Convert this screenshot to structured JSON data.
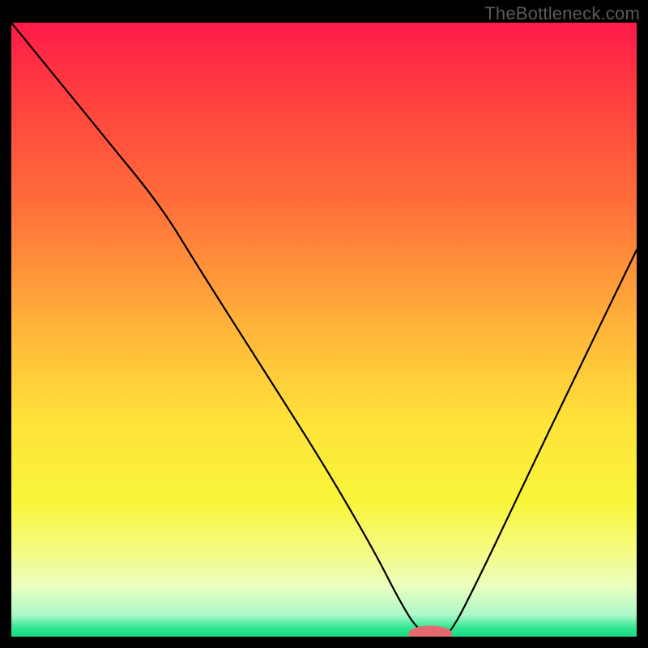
{
  "watermark": "TheBottleneck.com",
  "chart_data": {
    "type": "line",
    "title": "",
    "xlabel": "",
    "ylabel": "",
    "xlim": [
      0,
      100
    ],
    "ylim": [
      0,
      100
    ],
    "grid": false,
    "legend": false,
    "gradient_stops": [
      {
        "offset": 0.0,
        "color": "#ff1a4a"
      },
      {
        "offset": 0.12,
        "color": "#ff3f3f"
      },
      {
        "offset": 0.3,
        "color": "#ff703a"
      },
      {
        "offset": 0.5,
        "color": "#ffb53a"
      },
      {
        "offset": 0.65,
        "color": "#ffe33a"
      },
      {
        "offset": 0.78,
        "color": "#f8f53a"
      },
      {
        "offset": 0.86,
        "color": "#f6fb82"
      },
      {
        "offset": 0.92,
        "color": "#e8ffc0"
      },
      {
        "offset": 0.965,
        "color": "#aaf7c9"
      },
      {
        "offset": 0.985,
        "color": "#34e693"
      },
      {
        "offset": 1.0,
        "color": "#18db84"
      }
    ],
    "series": [
      {
        "name": "bottleneck-curve",
        "x": [
          0,
          8,
          16,
          24,
          30,
          40,
          50,
          58,
          62,
          65,
          68,
          70,
          75,
          82,
          90,
          100
        ],
        "y": [
          100,
          90,
          80,
          70,
          60,
          44,
          28,
          14,
          6,
          1,
          0,
          0,
          10,
          25,
          42,
          63
        ]
      }
    ],
    "marker": {
      "x": 67,
      "y": 0.5,
      "rx": 3.5,
      "ry": 1.3,
      "color": "#e46a6f"
    }
  }
}
